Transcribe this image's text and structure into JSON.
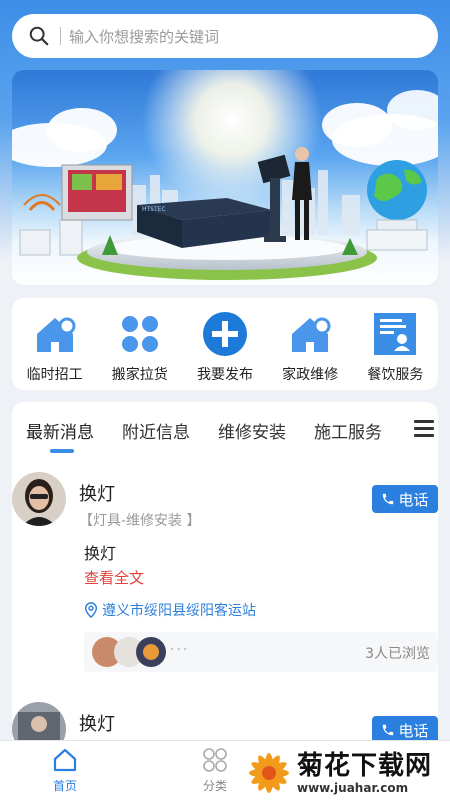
{
  "search": {
    "placeholder": "输入你想搜索的关键词"
  },
  "banner": {
    "brand_text": "HTSTEC"
  },
  "categories": [
    {
      "label": "临时招工",
      "icon": "house-gear-icon"
    },
    {
      "label": "搬家拉货",
      "icon": "four-petal-icon"
    },
    {
      "label": "我要发布",
      "icon": "plus-circle-icon"
    },
    {
      "label": "家政维修",
      "icon": "house-gear-icon"
    },
    {
      "label": "餐饮服务",
      "icon": "document-person-icon"
    }
  ],
  "tabs": [
    "最新消息",
    "附近信息",
    "维修安装",
    "施工服务"
  ],
  "posts": [
    {
      "title": "换灯",
      "tag": "【灯具-维修安装 】",
      "body": "换灯",
      "more": "查看全文",
      "location": "遵义市绥阳县绥阳客运站",
      "call": "电话",
      "dots": "···",
      "views": "3人已浏览"
    },
    {
      "title": "换灯",
      "call": "电话"
    }
  ],
  "bottom_nav": [
    {
      "label": "首页",
      "icon": "home-icon",
      "active": true
    },
    {
      "label": "分类",
      "icon": "category-icon",
      "active": false
    }
  ],
  "watermark": {
    "title": "菊花下载网",
    "url": "www.juahar.com"
  },
  "colors": {
    "accent": "#2b7fde",
    "link_red": "#e0403a",
    "bg_blue": "#3d8ee8"
  }
}
